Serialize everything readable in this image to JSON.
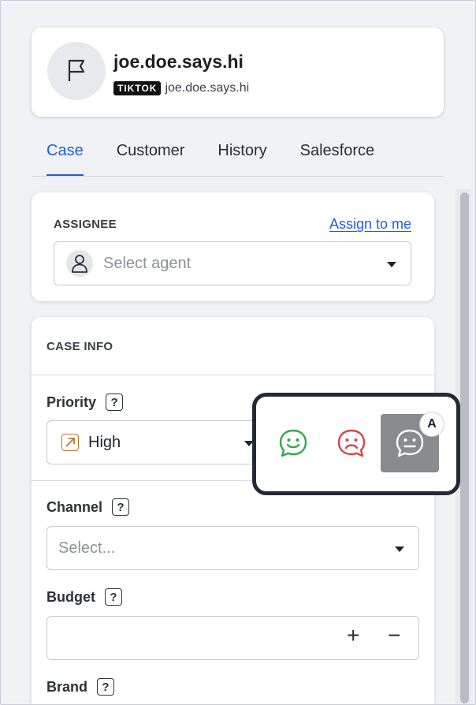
{
  "profile": {
    "handle": "joe.doe.says.hi",
    "platform_badge": "TIKTOK",
    "platform_handle": "joe.doe.says.hi"
  },
  "tabs": [
    {
      "label": "Case",
      "active": true
    },
    {
      "label": "Customer",
      "active": false
    },
    {
      "label": "History",
      "active": false
    },
    {
      "label": "Salesforce",
      "active": false
    }
  ],
  "assignee": {
    "label": "ASSIGNEE",
    "assign_link": "Assign to me",
    "placeholder": "Select agent"
  },
  "case_info": {
    "label": "CASE INFO",
    "priority": {
      "label": "Priority",
      "help": "?",
      "value": "High"
    },
    "channel": {
      "label": "Channel",
      "help": "?",
      "placeholder": "Select..."
    },
    "budget": {
      "label": "Budget",
      "help": "?",
      "plus": "+",
      "minus": "−"
    },
    "brand": {
      "label": "Brand",
      "help": "?"
    }
  },
  "sentiment": {
    "options": [
      {
        "name": "positive",
        "icon": "smile-chat-icon",
        "color": "#2fa84f"
      },
      {
        "name": "negative",
        "icon": "frown-chat-icon",
        "color": "#d84545"
      },
      {
        "name": "neutral",
        "icon": "neutral-chat-icon",
        "color": "#ffffff",
        "selected": true
      }
    ],
    "shortcut": "A"
  },
  "colors": {
    "accent": "#1f5fd6",
    "priority_high": "#b8782a"
  }
}
